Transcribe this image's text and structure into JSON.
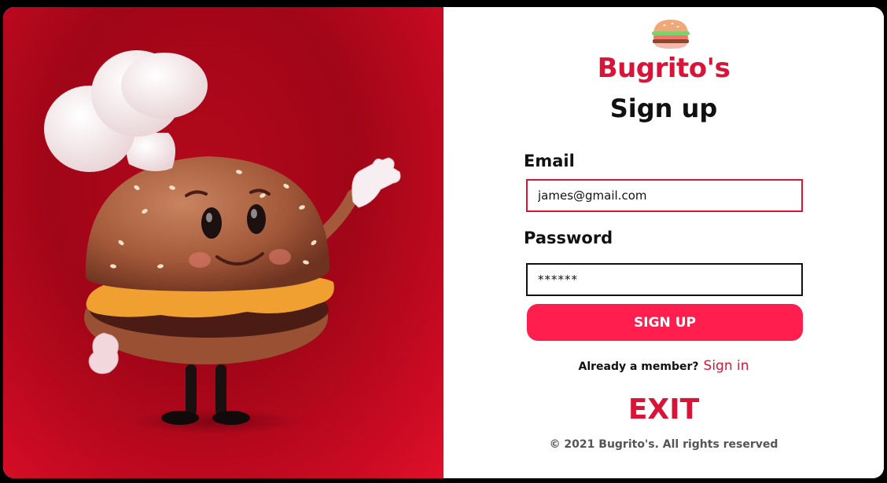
{
  "brand": {
    "name": "Bugrito's",
    "logo_icon": "burger-icon"
  },
  "form": {
    "heading": "Sign up",
    "email_label": "Email",
    "email_value": "james@gmail.com",
    "password_label": "Password",
    "password_value": "******",
    "submit_label": "SIGN UP"
  },
  "footer": {
    "member_prompt": "Already a member?",
    "signin_link": "Sign in",
    "exit_label": "EXIT",
    "copyright": "© 2021 Bugrito's. All rights reserved"
  },
  "colors": {
    "accent": "#d81439",
    "button": "#ff1e4d",
    "hero_bg": "#a00617"
  }
}
